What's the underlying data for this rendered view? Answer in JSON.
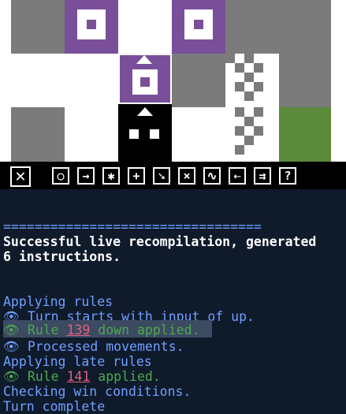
{
  "toolbar": {
    "buttons": [
      {
        "name": "clear-button",
        "glyph": "✕"
      },
      {
        "name": "action-button",
        "glyph": "○"
      },
      {
        "name": "arrow-right-button",
        "glyph": "→"
      },
      {
        "name": "star-button",
        "glyph": "✱"
      },
      {
        "name": "plus-button",
        "glyph": "+"
      },
      {
        "name": "sprite-button",
        "glyph": "➘"
      },
      {
        "name": "cross-button",
        "glyph": "⨯"
      },
      {
        "name": "wave-button",
        "glyph": "∿"
      },
      {
        "name": "left-arrow-button",
        "glyph": "⇠"
      },
      {
        "name": "list-button",
        "glyph": "⇉"
      },
      {
        "name": "help-button",
        "glyph": "?"
      }
    ]
  },
  "console": {
    "separator": "=================================",
    "recompile_line1": "Successful live recompilation, generated",
    "recompile_line2": "6 instructions.",
    "applying_rules": "Applying rules",
    "turn_starts": "👁 Turn starts with input of up.",
    "rule139_prefix": "👁 Rule ",
    "rule139_num": "139",
    "rule139_suffix": " down applied.",
    "processed": "👁 Processed movements.",
    "applying_late": "Applying late rules",
    "rule141_prefix": "👁 Rule ",
    "rule141_num": "141",
    "rule141_suffix": " applied.",
    "checking_win": "Checking win conditions.",
    "turn_complete": "Turn complete"
  }
}
